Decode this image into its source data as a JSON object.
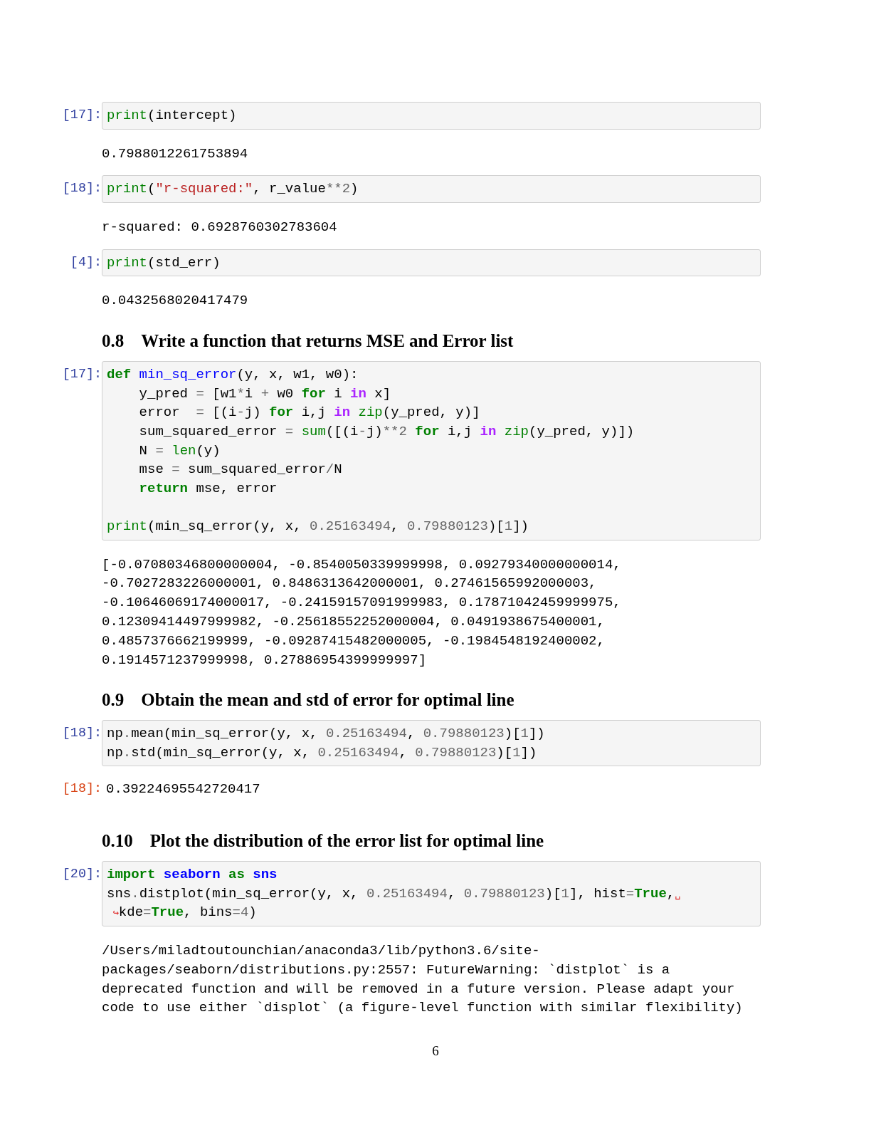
{
  "cells": [
    {
      "kind": "code",
      "prompt": "[17]:",
      "lines": [
        {
          "kind": "code",
          "tokens": [
            {
              "text": "print",
              "kind": "builtin"
            },
            {
              "text": "(intercept)",
              "kind": "plain"
            }
          ]
        }
      ]
    },
    {
      "kind": "output",
      "lines": [
        "0.7988012261753894"
      ]
    },
    {
      "kind": "code",
      "prompt": "[18]:",
      "lines": [
        {
          "kind": "code",
          "tokens": [
            {
              "text": "print",
              "kind": "builtin"
            },
            {
              "text": "(",
              "kind": "plain"
            },
            {
              "text": "\"r-squared:\"",
              "kind": "string"
            },
            {
              "text": ", r_value",
              "kind": "plain"
            },
            {
              "text": "**",
              "kind": "op"
            },
            {
              "text": "2",
              "kind": "number"
            },
            {
              "text": ")",
              "kind": "plain"
            }
          ]
        }
      ]
    },
    {
      "kind": "output",
      "lines": [
        "r-squared: 0.6928760302783604"
      ]
    },
    {
      "kind": "code",
      "prompt": "[4]:",
      "lines": [
        {
          "kind": "code",
          "tokens": [
            {
              "text": "print",
              "kind": "builtin"
            },
            {
              "text": "(std_err)",
              "kind": "plain"
            }
          ]
        }
      ]
    },
    {
      "kind": "output",
      "lines": [
        "0.0432568020417479"
      ]
    },
    {
      "kind": "heading",
      "number": "0.8",
      "title": "Write a function that returns MSE and Error list"
    },
    {
      "kind": "code",
      "prompt": "[17]:",
      "lines": [
        {
          "kind": "code",
          "tokens": [
            {
              "text": "def ",
              "kind": "keyword"
            },
            {
              "text": "min_sq_error",
              "kind": "function"
            },
            {
              "text": "(y, x, w1, w0):",
              "kind": "plain"
            }
          ]
        },
        {
          "kind": "code",
          "tokens": [
            {
              "text": "    y_pred ",
              "kind": "plain"
            },
            {
              "text": "=",
              "kind": "op"
            },
            {
              "text": " [w1",
              "kind": "plain"
            },
            {
              "text": "*",
              "kind": "op"
            },
            {
              "text": "i ",
              "kind": "plain"
            },
            {
              "text": "+",
              "kind": "op"
            },
            {
              "text": " w0 ",
              "kind": "plain"
            },
            {
              "text": "for",
              "kind": "keyword"
            },
            {
              "text": " i ",
              "kind": "plain"
            },
            {
              "text": "in",
              "kind": "operator_word"
            },
            {
              "text": " x]",
              "kind": "plain"
            }
          ]
        },
        {
          "kind": "code",
          "tokens": [
            {
              "text": "    error  ",
              "kind": "plain"
            },
            {
              "text": "=",
              "kind": "op"
            },
            {
              "text": " [(i",
              "kind": "plain"
            },
            {
              "text": "-",
              "kind": "op"
            },
            {
              "text": "j) ",
              "kind": "plain"
            },
            {
              "text": "for",
              "kind": "keyword"
            },
            {
              "text": " i,j ",
              "kind": "plain"
            },
            {
              "text": "in ",
              "kind": "operator_word"
            },
            {
              "text": "zip",
              "kind": "builtin"
            },
            {
              "text": "(y_pred, y)]",
              "kind": "plain"
            }
          ]
        },
        {
          "kind": "code",
          "tokens": [
            {
              "text": "    sum_squared_error ",
              "kind": "plain"
            },
            {
              "text": "= ",
              "kind": "op"
            },
            {
              "text": "sum",
              "kind": "builtin"
            },
            {
              "text": "([(i",
              "kind": "plain"
            },
            {
              "text": "-",
              "kind": "op"
            },
            {
              "text": "j)",
              "kind": "plain"
            },
            {
              "text": "**",
              "kind": "op"
            },
            {
              "text": "2 ",
              "kind": "number"
            },
            {
              "text": "for",
              "kind": "keyword"
            },
            {
              "text": " i,j ",
              "kind": "plain"
            },
            {
              "text": "in ",
              "kind": "operator_word"
            },
            {
              "text": "zip",
              "kind": "builtin"
            },
            {
              "text": "(y_pred, y)])",
              "kind": "plain"
            }
          ]
        },
        {
          "kind": "code",
          "tokens": [
            {
              "text": "    N ",
              "kind": "plain"
            },
            {
              "text": "= ",
              "kind": "op"
            },
            {
              "text": "len",
              "kind": "builtin"
            },
            {
              "text": "(y)",
              "kind": "plain"
            }
          ]
        },
        {
          "kind": "code",
          "tokens": [
            {
              "text": "    mse ",
              "kind": "plain"
            },
            {
              "text": "=",
              "kind": "op"
            },
            {
              "text": " sum_squared_error",
              "kind": "plain"
            },
            {
              "text": "/",
              "kind": "op"
            },
            {
              "text": "N",
              "kind": "plain"
            }
          ]
        },
        {
          "kind": "code",
          "tokens": [
            {
              "text": "    return",
              "kind": "keyword"
            },
            {
              "text": " mse, error",
              "kind": "plain"
            }
          ]
        },
        {
          "kind": "blank"
        },
        {
          "kind": "code",
          "tokens": [
            {
              "text": "print",
              "kind": "builtin"
            },
            {
              "text": "(min_sq_error(y, x, ",
              "kind": "plain"
            },
            {
              "text": "0.25163494",
              "kind": "number"
            },
            {
              "text": ", ",
              "kind": "plain"
            },
            {
              "text": "0.79880123",
              "kind": "number"
            },
            {
              "text": ")[",
              "kind": "plain"
            },
            {
              "text": "1",
              "kind": "number"
            },
            {
              "text": "])",
              "kind": "plain"
            }
          ]
        }
      ]
    },
    {
      "kind": "output",
      "lines": [
        "[-0.07080346800000004, -0.8540050339999998, 0.09279340000000014,",
        "-0.7027283226000001, 0.8486313642000001, 0.27461565992000003,",
        "-0.10646069174000017, -0.24159157091999983, 0.17871042459999975,",
        "0.12309414497999982, -0.25618552252000004, 0.0491938675400001,",
        "0.4857376662199999, -0.09287415482000005, -0.1984548192400002,",
        "0.1914571237999998, 0.27886954399999997]"
      ]
    },
    {
      "kind": "heading",
      "number": "0.9",
      "title": "Obtain the mean and std of error for optimal line"
    },
    {
      "kind": "code",
      "prompt": "[18]:",
      "lines": [
        {
          "kind": "code",
          "tokens": [
            {
              "text": "np",
              "kind": "plain"
            },
            {
              "text": ".",
              "kind": "op"
            },
            {
              "text": "mean(min_sq_error(y, x, ",
              "kind": "plain"
            },
            {
              "text": "0.25163494",
              "kind": "number"
            },
            {
              "text": ", ",
              "kind": "plain"
            },
            {
              "text": "0.79880123",
              "kind": "number"
            },
            {
              "text": ")[",
              "kind": "plain"
            },
            {
              "text": "1",
              "kind": "number"
            },
            {
              "text": "])",
              "kind": "plain"
            }
          ]
        },
        {
          "kind": "code",
          "tokens": [
            {
              "text": "np",
              "kind": "plain"
            },
            {
              "text": ".",
              "kind": "op"
            },
            {
              "text": "std(min_sq_error(y, x, ",
              "kind": "plain"
            },
            {
              "text": "0.25163494",
              "kind": "number"
            },
            {
              "text": ", ",
              "kind": "plain"
            },
            {
              "text": "0.79880123",
              "kind": "number"
            },
            {
              "text": ")[",
              "kind": "plain"
            },
            {
              "text": "1",
              "kind": "number"
            },
            {
              "text": "])",
              "kind": "plain"
            }
          ]
        }
      ]
    },
    {
      "kind": "result",
      "prompt": "[18]:",
      "lines": [
        "0.39224695542720417"
      ]
    },
    {
      "kind": "heading",
      "number": "0.10",
      "title": "Plot the distribution of the error list for optimal line"
    },
    {
      "kind": "code",
      "prompt": "[20]:",
      "lines": [
        {
          "kind": "code",
          "tokens": [
            {
              "text": "import ",
              "kind": "keyword"
            },
            {
              "text": "seaborn ",
              "kind": "namespace"
            },
            {
              "text": "as ",
              "kind": "keyword"
            },
            {
              "text": "sns",
              "kind": "namespace"
            }
          ]
        },
        {
          "kind": "code",
          "tokens": [
            {
              "text": "sns",
              "kind": "plain"
            },
            {
              "text": ".",
              "kind": "op"
            },
            {
              "text": "distplot(min_sq_error(y, x, ",
              "kind": "plain"
            },
            {
              "text": "0.25163494",
              "kind": "number"
            },
            {
              "text": ", ",
              "kind": "plain"
            },
            {
              "text": "0.79880123",
              "kind": "number"
            },
            {
              "text": ")[",
              "kind": "plain"
            },
            {
              "text": "1",
              "kind": "number"
            },
            {
              "text": "], hist",
              "kind": "plain"
            },
            {
              "text": "=",
              "kind": "op"
            },
            {
              "text": "True",
              "kind": "keyword"
            },
            {
              "text": ",",
              "kind": "plain"
            },
            {
              "text": "␣",
              "kind": "wrap"
            }
          ]
        },
        {
          "kind": "code",
          "tokens": [
            {
              "text": " ↪",
              "kind": "wrap"
            },
            {
              "text": "kde",
              "kind": "plain"
            },
            {
              "text": "=",
              "kind": "op"
            },
            {
              "text": "True",
              "kind": "keyword"
            },
            {
              "text": ", bins",
              "kind": "plain"
            },
            {
              "text": "=",
              "kind": "op"
            },
            {
              "text": "4",
              "kind": "number"
            },
            {
              "text": ")",
              "kind": "plain"
            }
          ]
        }
      ]
    },
    {
      "kind": "output",
      "lines": [
        "/Users/miladtoutounchian/anaconda3/lib/python3.6/site-",
        "packages/seaborn/distributions.py:2557: FutureWarning: `distplot` is a",
        "deprecated function and will be removed in a future version. Please adapt your",
        "code to use either `displot` (a figure-level function with similar flexibility)"
      ]
    }
  ],
  "page_number": "6"
}
